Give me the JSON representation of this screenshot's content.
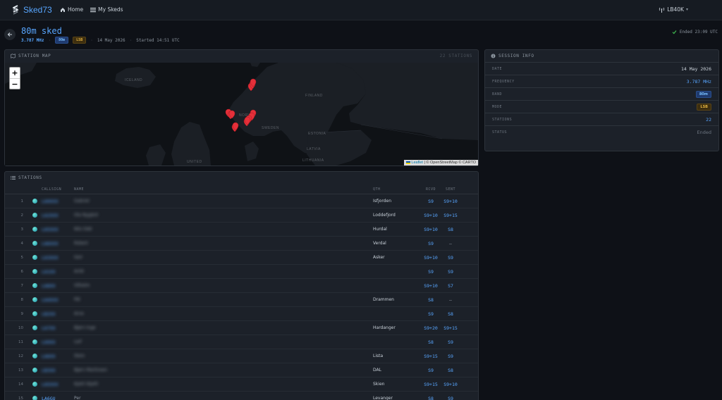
{
  "app": {
    "name": "Sked73"
  },
  "nav": {
    "home": "Home",
    "my_skeds": "My Skeds",
    "user": "LB40K"
  },
  "session": {
    "title": "80m sked",
    "frequency": "3.787 MHz",
    "band": "80m",
    "mode": "LSB",
    "date": "14 May 2026",
    "started": "Started 14:51 UTC",
    "ended": "Ended 23:09 UTC"
  },
  "map": {
    "header": "STATION MAP",
    "count": "22 STATIONS",
    "zoom_in": "+",
    "zoom_out": "−",
    "attribution_leaflet": "Leaflet",
    "attribution_rest": " | © OpenStreetMap © CARTO",
    "labels": {
      "iceland": "ICELAND",
      "finland": "FINLAND",
      "norway": "NORWAY",
      "sweden": "SWEDEN",
      "estonia": "ESTONIA",
      "latvia": "LATVIA",
      "lithuania": "LITHUANIA",
      "united": "UNITED"
    }
  },
  "info": {
    "header": "SESSION INFO",
    "rows": [
      {
        "key": "DATE",
        "value": "14 May 2026"
      },
      {
        "key": "FREQUENCY",
        "value": "3.787 MHz"
      },
      {
        "key": "BAND",
        "value": "80m"
      },
      {
        "key": "MODE",
        "value": "LSB"
      },
      {
        "key": "STATIONS",
        "value": "22"
      },
      {
        "key": "STATUS",
        "value": "Ended"
      }
    ]
  },
  "stations": {
    "header": "STATIONS",
    "columns": {
      "callsign": "CALLSIGN",
      "name": "NAME",
      "qth": "QTH",
      "rcvd": "RCVD",
      "sent": "SENT"
    },
    "rows": [
      {
        "n": "1",
        "call": "LA9XXX",
        "name": "Gabriel",
        "qth": "Isfjorden",
        "rcvd": "S9",
        "sent": "S9+10",
        "blur": true
      },
      {
        "n": "2",
        "call": "LA2XXX",
        "name": "Ola Nygård",
        "qth": "Loddefjord",
        "rcvd": "S9+10",
        "sent": "S9+15",
        "blur": true
      },
      {
        "n": "3",
        "call": "LA5XXX",
        "name": "Nils Odd",
        "qth": "Hurdal",
        "rcvd": "S9+10",
        "sent": "S8",
        "blur": true
      },
      {
        "n": "4",
        "call": "LA6XXX",
        "name": "Robert",
        "qth": "Verdal",
        "rcvd": "S9",
        "sent": "–",
        "blur": true
      },
      {
        "n": "5",
        "call": "LA3XXX",
        "name": "Geir",
        "qth": "Asker",
        "rcvd": "S9+10",
        "sent": "S9",
        "blur": true
      },
      {
        "n": "6",
        "call": "LA1XX",
        "name": "Arild",
        "qth": "",
        "rcvd": "S9",
        "sent": "S9",
        "blur": true
      },
      {
        "n": "7",
        "call": "LA8XX",
        "name": "Vilhelm",
        "qth": "",
        "rcvd": "S9+10",
        "sent": "S7",
        "blur": true
      },
      {
        "n": "8",
        "call": "LA4XXX",
        "name": "Pål",
        "qth": "Drammen",
        "rcvd": "S8",
        "sent": "–",
        "blur": true
      },
      {
        "n": "9",
        "call": "LB2XX",
        "name": "Arne",
        "qth": "",
        "rcvd": "S9",
        "sent": "S8",
        "blur": true
      },
      {
        "n": "10",
        "call": "LA7XX",
        "name": "Bjørn Inge",
        "qth": "Hardanger",
        "rcvd": "S9+20",
        "sent": "S9+15",
        "blur": true
      },
      {
        "n": "11",
        "call": "LA9XX",
        "name": "Leif",
        "qth": "",
        "rcvd": "S8",
        "sent": "S9",
        "blur": true
      },
      {
        "n": "12",
        "call": "LA6XX",
        "name": "Stein",
        "qth": "Lista",
        "rcvd": "S9+15",
        "sent": "S9",
        "blur": true
      },
      {
        "n": "13",
        "call": "LB3XX",
        "name": "Bjørn Martinsen",
        "qth": "DAL",
        "rcvd": "S9",
        "sent": "S8",
        "blur": true
      },
      {
        "n": "14",
        "call": "LA5XXX",
        "name": "Kjetil (Kjell)",
        "qth": "Skien",
        "rcvd": "S9+15",
        "sent": "S9+10",
        "blur": true
      },
      {
        "n": "15",
        "call": "LA6GU",
        "name": "Per",
        "qth": "Levanger",
        "rcvd": "S8",
        "sent": "S9",
        "blur": false
      }
    ]
  },
  "colors": {
    "accent": "#58a6ff",
    "marker": "#e5303a",
    "ok": "#3fb950"
  }
}
